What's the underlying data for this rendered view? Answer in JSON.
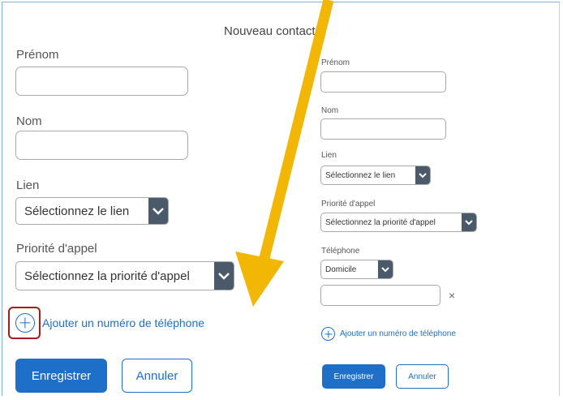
{
  "window": {
    "title": "Nouveau contact"
  },
  "left_form": {
    "first_name": {
      "label": "Prénom",
      "value": ""
    },
    "last_name": {
      "label": "Nom",
      "value": ""
    },
    "link": {
      "label": "Lien",
      "selected": "Sélectionnez le lien"
    },
    "priority": {
      "label": "Priorité d'appel",
      "selected": "Sélectionnez la priorité d'appel"
    },
    "add_phone": "Ajouter un numéro de téléphone",
    "save_label": "Enregistrer",
    "cancel_label": "Annuler"
  },
  "right_form": {
    "first_name": {
      "label": "Prénom",
      "value": ""
    },
    "last_name": {
      "label": "Nom",
      "value": ""
    },
    "link": {
      "label": "Lien",
      "selected": "Sélectionnez le lien"
    },
    "priority": {
      "label": "Priorité d'appel",
      "selected": "Sélectionnez la priorité d'appel"
    },
    "phone": {
      "label": "Téléphone",
      "type_selected": "Domicile",
      "number_value": "",
      "remove_icon": "×"
    },
    "add_phone": "Ajouter un numéro de téléphone",
    "save_label": "Enregistrer",
    "cancel_label": "Annuler"
  },
  "colors": {
    "accent": "#1e6fc8",
    "arrow": "#f2b705",
    "highlight": "#a51c1c",
    "chevron_bg": "#4a5a6a"
  },
  "icons": {
    "add": "plus-circle-icon",
    "dropdown": "chevron-down-icon",
    "remove": "close-icon"
  }
}
